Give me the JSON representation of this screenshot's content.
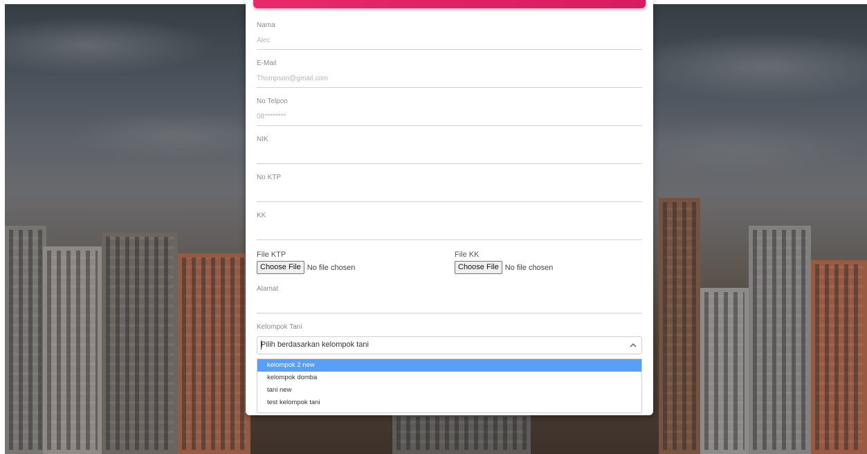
{
  "form": {
    "fields": [
      {
        "label": "Nama",
        "value": "Alec"
      },
      {
        "label": "E-Mail",
        "value": "Thompson@gmail.com"
      },
      {
        "label": "No Telpon",
        "value": "08********"
      },
      {
        "label": "NIK",
        "value": ""
      },
      {
        "label": "No KTP",
        "value": ""
      },
      {
        "label": "KK",
        "value": ""
      }
    ],
    "file_ktp": {
      "label": "File KTP",
      "button": "Choose File",
      "status": "No file chosen"
    },
    "file_kk": {
      "label": "File KK",
      "button": "Choose File",
      "status": "No file chosen"
    },
    "alamat": {
      "label": "Alamat",
      "value": ""
    },
    "kelompok_tani": {
      "label": "Kelompok Tani",
      "placeholder": "Pilih berdasarkan kelompok tani",
      "options": [
        "kelompok 2 new",
        "kelompok domba",
        "tani new",
        "test kelompok tani"
      ],
      "highlighted_index": 0
    }
  },
  "colors": {
    "accent": "#e91e63",
    "option_highlight": "#5a9ef5"
  }
}
